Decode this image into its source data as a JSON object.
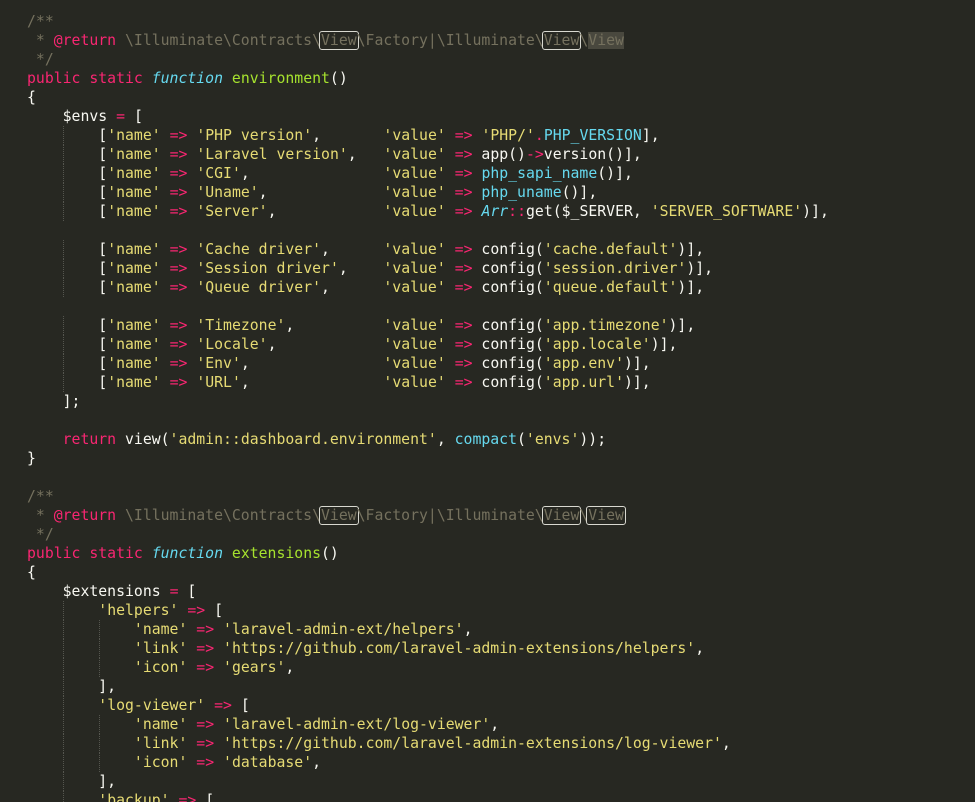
{
  "colors": {
    "background": "#272822",
    "comment": "#75715e",
    "keyword": "#f92672",
    "string": "#e6db74",
    "function_name": "#a6e22e",
    "builtin": "#66d9ef",
    "plain": "#f8f8f2"
  },
  "code": {
    "lines": [
      [
        [
          "c",
          "/**"
        ]
      ],
      [
        [
          "c",
          " * "
        ],
        [
          "k",
          "@return"
        ],
        [
          "c",
          " \\Illuminate\\Contracts\\"
        ],
        [
          "h",
          "View"
        ],
        [
          "c",
          "\\Factory|\\Illuminate\\"
        ],
        [
          "h",
          "View"
        ],
        [
          "c",
          "\\"
        ],
        [
          "hl",
          "View"
        ]
      ],
      [
        [
          "c",
          " */"
        ]
      ],
      [
        [
          "k",
          "public static "
        ],
        [
          "sf",
          "function"
        ],
        [
          "p",
          " "
        ],
        [
          "f",
          "environment"
        ],
        [
          "p",
          "()"
        ]
      ],
      [
        [
          "p",
          "{"
        ]
      ],
      [
        [
          "p",
          "    "
        ],
        [
          "v",
          "$envs"
        ],
        [
          "p",
          " "
        ],
        [
          "k",
          "="
        ],
        [
          "p",
          " ["
        ]
      ],
      [
        [
          "p",
          "        ["
        ],
        [
          "s",
          "'name'"
        ],
        [
          "p",
          " "
        ],
        [
          "k",
          "=>"
        ],
        [
          "p",
          " "
        ],
        [
          "s",
          "'PHP version'"
        ],
        [
          "p",
          ",       "
        ],
        [
          "s",
          "'value'"
        ],
        [
          "p",
          " "
        ],
        [
          "k",
          "=>"
        ],
        [
          "p",
          " "
        ],
        [
          "s",
          "'PHP/'"
        ],
        [
          "k",
          "."
        ],
        [
          "b",
          "PHP_VERSION"
        ],
        [
          "p",
          "],"
        ]
      ],
      [
        [
          "p",
          "        ["
        ],
        [
          "s",
          "'name'"
        ],
        [
          "p",
          " "
        ],
        [
          "k",
          "=>"
        ],
        [
          "p",
          " "
        ],
        [
          "s",
          "'Laravel version'"
        ],
        [
          "p",
          ",   "
        ],
        [
          "s",
          "'value'"
        ],
        [
          "p",
          " "
        ],
        [
          "k",
          "=>"
        ],
        [
          "p",
          " app()"
        ],
        [
          "k",
          "->"
        ],
        [
          "p",
          "version()],"
        ]
      ],
      [
        [
          "p",
          "        ["
        ],
        [
          "s",
          "'name'"
        ],
        [
          "p",
          " "
        ],
        [
          "k",
          "=>"
        ],
        [
          "p",
          " "
        ],
        [
          "s",
          "'CGI'"
        ],
        [
          "p",
          ",               "
        ],
        [
          "s",
          "'value'"
        ],
        [
          "p",
          " "
        ],
        [
          "k",
          "=>"
        ],
        [
          "p",
          " "
        ],
        [
          "b",
          "php_sapi_name"
        ],
        [
          "p",
          "()],"
        ]
      ],
      [
        [
          "p",
          "        ["
        ],
        [
          "s",
          "'name'"
        ],
        [
          "p",
          " "
        ],
        [
          "k",
          "=>"
        ],
        [
          "p",
          " "
        ],
        [
          "s",
          "'Uname'"
        ],
        [
          "p",
          ",             "
        ],
        [
          "s",
          "'value'"
        ],
        [
          "p",
          " "
        ],
        [
          "k",
          "=>"
        ],
        [
          "p",
          " "
        ],
        [
          "b",
          "php_uname"
        ],
        [
          "p",
          "()],"
        ]
      ],
      [
        [
          "p",
          "        ["
        ],
        [
          "s",
          "'name'"
        ],
        [
          "p",
          " "
        ],
        [
          "k",
          "=>"
        ],
        [
          "p",
          " "
        ],
        [
          "s",
          "'Server'"
        ],
        [
          "p",
          ",            "
        ],
        [
          "s",
          "'value'"
        ],
        [
          "p",
          " "
        ],
        [
          "k",
          "=>"
        ],
        [
          "p",
          " "
        ],
        [
          "i",
          "Arr"
        ],
        [
          "k",
          "::"
        ],
        [
          "p",
          "get($_SERVER, "
        ],
        [
          "s",
          "'SERVER_SOFTWARE'"
        ],
        [
          "p",
          ")],"
        ]
      ],
      [
        [
          "p",
          ""
        ]
      ],
      [
        [
          "p",
          "        ["
        ],
        [
          "s",
          "'name'"
        ],
        [
          "p",
          " "
        ],
        [
          "k",
          "=>"
        ],
        [
          "p",
          " "
        ],
        [
          "s",
          "'Cache driver'"
        ],
        [
          "p",
          ",      "
        ],
        [
          "s",
          "'value'"
        ],
        [
          "p",
          " "
        ],
        [
          "k",
          "=>"
        ],
        [
          "p",
          " config("
        ],
        [
          "s",
          "'cache.default'"
        ],
        [
          "p",
          ")],"
        ]
      ],
      [
        [
          "p",
          "        ["
        ],
        [
          "s",
          "'name'"
        ],
        [
          "p",
          " "
        ],
        [
          "k",
          "=>"
        ],
        [
          "p",
          " "
        ],
        [
          "s",
          "'Session driver'"
        ],
        [
          "p",
          ",    "
        ],
        [
          "s",
          "'value'"
        ],
        [
          "p",
          " "
        ],
        [
          "k",
          "=>"
        ],
        [
          "p",
          " config("
        ],
        [
          "s",
          "'session.driver'"
        ],
        [
          "p",
          ")],"
        ]
      ],
      [
        [
          "p",
          "        ["
        ],
        [
          "s",
          "'name'"
        ],
        [
          "p",
          " "
        ],
        [
          "k",
          "=>"
        ],
        [
          "p",
          " "
        ],
        [
          "s",
          "'Queue driver'"
        ],
        [
          "p",
          ",      "
        ],
        [
          "s",
          "'value'"
        ],
        [
          "p",
          " "
        ],
        [
          "k",
          "=>"
        ],
        [
          "p",
          " config("
        ],
        [
          "s",
          "'queue.default'"
        ],
        [
          "p",
          ")],"
        ]
      ],
      [
        [
          "p",
          ""
        ]
      ],
      [
        [
          "p",
          "        ["
        ],
        [
          "s",
          "'name'"
        ],
        [
          "p",
          " "
        ],
        [
          "k",
          "=>"
        ],
        [
          "p",
          " "
        ],
        [
          "s",
          "'Timezone'"
        ],
        [
          "p",
          ",          "
        ],
        [
          "s",
          "'value'"
        ],
        [
          "p",
          " "
        ],
        [
          "k",
          "=>"
        ],
        [
          "p",
          " config("
        ],
        [
          "s",
          "'app.timezone'"
        ],
        [
          "p",
          ")],"
        ]
      ],
      [
        [
          "p",
          "        ["
        ],
        [
          "s",
          "'name'"
        ],
        [
          "p",
          " "
        ],
        [
          "k",
          "=>"
        ],
        [
          "p",
          " "
        ],
        [
          "s",
          "'Locale'"
        ],
        [
          "p",
          ",            "
        ],
        [
          "s",
          "'value'"
        ],
        [
          "p",
          " "
        ],
        [
          "k",
          "=>"
        ],
        [
          "p",
          " config("
        ],
        [
          "s",
          "'app.locale'"
        ],
        [
          "p",
          ")],"
        ]
      ],
      [
        [
          "p",
          "        ["
        ],
        [
          "s",
          "'name'"
        ],
        [
          "p",
          " "
        ],
        [
          "k",
          "=>"
        ],
        [
          "p",
          " "
        ],
        [
          "s",
          "'Env'"
        ],
        [
          "p",
          ",               "
        ],
        [
          "s",
          "'value'"
        ],
        [
          "p",
          " "
        ],
        [
          "k",
          "=>"
        ],
        [
          "p",
          " config("
        ],
        [
          "s",
          "'app.env'"
        ],
        [
          "p",
          ")],"
        ]
      ],
      [
        [
          "p",
          "        ["
        ],
        [
          "s",
          "'name'"
        ],
        [
          "p",
          " "
        ],
        [
          "k",
          "=>"
        ],
        [
          "p",
          " "
        ],
        [
          "s",
          "'URL'"
        ],
        [
          "p",
          ",               "
        ],
        [
          "s",
          "'value'"
        ],
        [
          "p",
          " "
        ],
        [
          "k",
          "=>"
        ],
        [
          "p",
          " config("
        ],
        [
          "s",
          "'app.url'"
        ],
        [
          "p",
          ")],"
        ]
      ],
      [
        [
          "p",
          "    ];"
        ]
      ],
      [
        [
          "p",
          ""
        ]
      ],
      [
        [
          "p",
          "    "
        ],
        [
          "k",
          "return"
        ],
        [
          "p",
          " view("
        ],
        [
          "s",
          "'admin::dashboard.environment'"
        ],
        [
          "p",
          ", "
        ],
        [
          "b",
          "compact"
        ],
        [
          "p",
          "("
        ],
        [
          "s",
          "'envs'"
        ],
        [
          "p",
          "));"
        ]
      ],
      [
        [
          "p",
          "}"
        ]
      ],
      [
        [
          "p",
          ""
        ]
      ],
      [
        [
          "c",
          "/**"
        ]
      ],
      [
        [
          "c",
          " * "
        ],
        [
          "k",
          "@return"
        ],
        [
          "c",
          " \\Illuminate\\Contracts\\"
        ],
        [
          "h",
          "View"
        ],
        [
          "c",
          "\\Factory|\\Illuminate\\"
        ],
        [
          "h",
          "View"
        ],
        [
          "c",
          "\\"
        ],
        [
          "h",
          "View"
        ]
      ],
      [
        [
          "c",
          " */"
        ]
      ],
      [
        [
          "k",
          "public static "
        ],
        [
          "sf",
          "function"
        ],
        [
          "p",
          " "
        ],
        [
          "f",
          "extensions"
        ],
        [
          "p",
          "()"
        ]
      ],
      [
        [
          "p",
          "{"
        ]
      ],
      [
        [
          "p",
          "    "
        ],
        [
          "v",
          "$extensions"
        ],
        [
          "p",
          " "
        ],
        [
          "k",
          "="
        ],
        [
          "p",
          " ["
        ]
      ],
      [
        [
          "p",
          "        "
        ],
        [
          "s",
          "'helpers'"
        ],
        [
          "p",
          " "
        ],
        [
          "k",
          "=>"
        ],
        [
          "p",
          " ["
        ]
      ],
      [
        [
          "p",
          "            "
        ],
        [
          "s",
          "'name'"
        ],
        [
          "p",
          " "
        ],
        [
          "k",
          "=>"
        ],
        [
          "p",
          " "
        ],
        [
          "s",
          "'laravel-admin-ext/helpers'"
        ],
        [
          "p",
          ","
        ]
      ],
      [
        [
          "p",
          "            "
        ],
        [
          "s",
          "'link'"
        ],
        [
          "p",
          " "
        ],
        [
          "k",
          "=>"
        ],
        [
          "p",
          " "
        ],
        [
          "s",
          "'https://github.com/laravel-admin-extensions/helpers'"
        ],
        [
          "p",
          ","
        ]
      ],
      [
        [
          "p",
          "            "
        ],
        [
          "s",
          "'icon'"
        ],
        [
          "p",
          " "
        ],
        [
          "k",
          "=>"
        ],
        [
          "p",
          " "
        ],
        [
          "s",
          "'gears'"
        ],
        [
          "p",
          ","
        ]
      ],
      [
        [
          "p",
          "        ],"
        ]
      ],
      [
        [
          "p",
          "        "
        ],
        [
          "s",
          "'log-viewer'"
        ],
        [
          "p",
          " "
        ],
        [
          "k",
          "=>"
        ],
        [
          "p",
          " ["
        ]
      ],
      [
        [
          "p",
          "            "
        ],
        [
          "s",
          "'name'"
        ],
        [
          "p",
          " "
        ],
        [
          "k",
          "=>"
        ],
        [
          "p",
          " "
        ],
        [
          "s",
          "'laravel-admin-ext/log-viewer'"
        ],
        [
          "p",
          ","
        ]
      ],
      [
        [
          "p",
          "            "
        ],
        [
          "s",
          "'link'"
        ],
        [
          "p",
          " "
        ],
        [
          "k",
          "=>"
        ],
        [
          "p",
          " "
        ],
        [
          "s",
          "'https://github.com/laravel-admin-extensions/log-viewer'"
        ],
        [
          "p",
          ","
        ]
      ],
      [
        [
          "p",
          "            "
        ],
        [
          "s",
          "'icon'"
        ],
        [
          "p",
          " "
        ],
        [
          "k",
          "=>"
        ],
        [
          "p",
          " "
        ],
        [
          "s",
          "'database'"
        ],
        [
          "p",
          ","
        ]
      ],
      [
        [
          "p",
          "        ],"
        ]
      ],
      [
        [
          "p",
          "        "
        ],
        [
          "s",
          "'backup'"
        ],
        [
          "p",
          " "
        ],
        [
          "k",
          "=>"
        ],
        [
          "p",
          " ["
        ]
      ]
    ]
  }
}
